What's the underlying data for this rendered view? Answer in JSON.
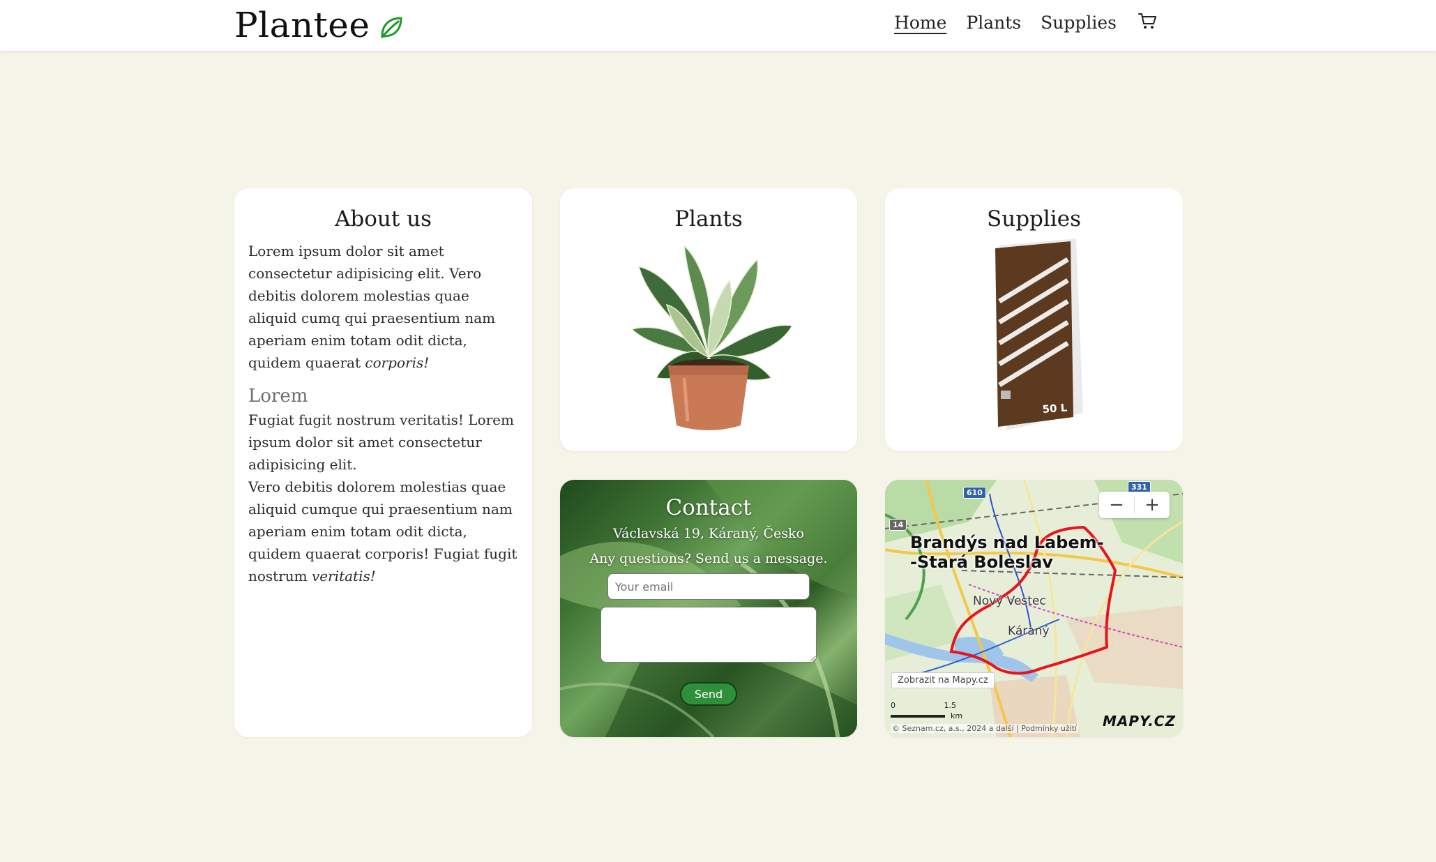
{
  "navbar": {
    "brand": "Plantee",
    "links": [
      {
        "label": "Home",
        "active": true
      },
      {
        "label": "Plants",
        "active": false
      },
      {
        "label": "Supplies",
        "active": false
      }
    ]
  },
  "about": {
    "title": "About us",
    "paragraph1_plain": "Lorem ipsum dolor sit amet consectetur adipisicing elit. Vero debitis dolorem molestias quae aliquid cumq qui praesentium nam aperiam enim totam odit dicta, quidem quaerat ",
    "paragraph1_italic": "corporis!",
    "subtitle": "Lorem",
    "paragraph2": "Fugiat fugit nostrum veritatis! Lorem ipsum dolor sit amet consectetur adipisicing elit.",
    "paragraph3_plain": "Vero debitis dolorem molestias quae aliquid cumque qui praesentium nam aperiam enim totam odit dicta, quidem quaerat corporis! Fugiat fugit nostrum ",
    "paragraph3_italic": "veritatis!"
  },
  "plants_card": {
    "title": "Plants"
  },
  "supplies_card": {
    "title": "Supplies",
    "bag_volume": "50 L"
  },
  "contact": {
    "title": "Contact",
    "address": "Václavská 19, Káraný, Česko",
    "question": "Any questions? Send us a message.",
    "email_placeholder": "Your email",
    "message_value": "",
    "send_label": "Send"
  },
  "map": {
    "zoom_out": "−",
    "zoom_in": "+",
    "city_line1": "Brandýs nad Labem-",
    "city_line2": "-Stará Boleslav",
    "place_novy_vestec": "Nový Vestec",
    "place_karany": "Káraný",
    "road_610": "610",
    "road_331": "331",
    "road_14": "14",
    "view_link": "Zobrazit na Mapy.cz",
    "scale_zero": "0",
    "scale_value": "1.5",
    "scale_unit": "km",
    "copyright": "© Seznam.cz, a.s., 2024 a další | Podmínky užití",
    "logo": "MAPY.CZ",
    "route_color": "#e8141d"
  }
}
